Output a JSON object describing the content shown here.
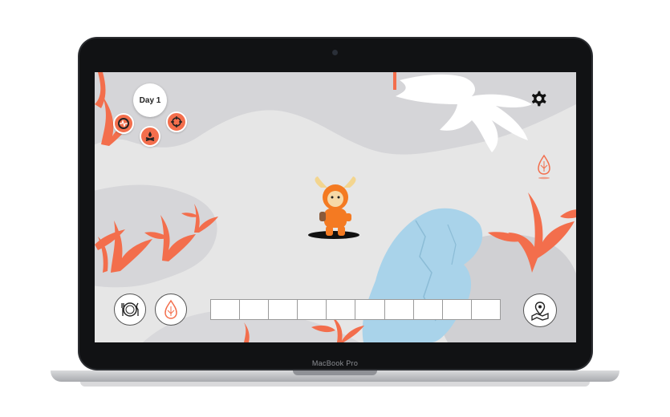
{
  "device": {
    "label": "MacBook Pro"
  },
  "hud": {
    "day_label": "Day 1",
    "inventory_slots": 10
  },
  "icons": {
    "day": "day-badge",
    "mini_buttons": [
      "heart-rate-icon",
      "crosshair-icon",
      "campfire-icon"
    ],
    "settings": "gear-icon",
    "water": "water-drop-icon",
    "food": "fork-knife-plate-icon",
    "map": "map-pin-icon"
  },
  "colors": {
    "accent": "#f36e4c",
    "ground": "#e6e6e6",
    "ice": "#a9d3ea",
    "rock": "#d6d6d8"
  }
}
